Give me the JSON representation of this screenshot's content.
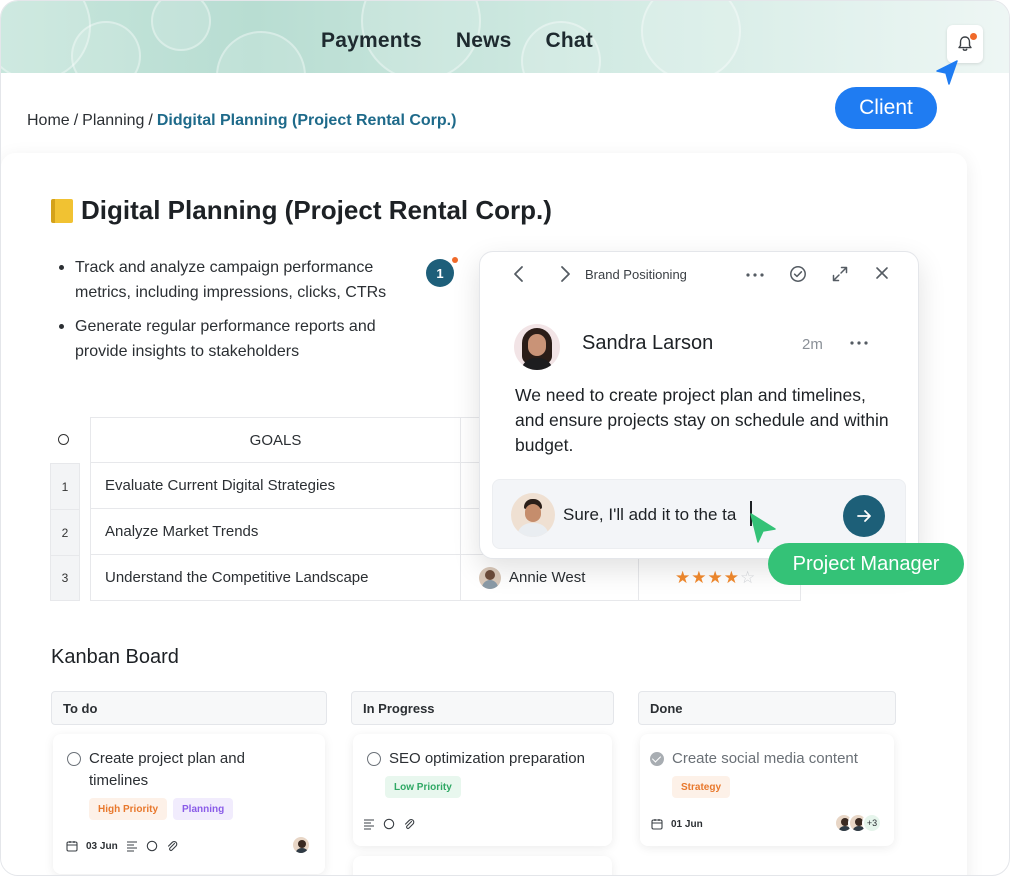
{
  "nav": {
    "items": [
      "Payments",
      "News",
      "Chat"
    ]
  },
  "cursors": {
    "client_label": "Client",
    "pm_label": "Project Manager"
  },
  "breadcrumb": {
    "home": "Home",
    "planning": "Planning",
    "current": "Didgital Planning (Project Rental Corp.)"
  },
  "page": {
    "title": "Digital Planning (Project Rental Corp.)",
    "bullets": [
      "Track and analyze campaign performance metrics, including impressions, clicks, CTRs",
      "Generate regular performance reports and provide insights to stakeholders"
    ],
    "comment_marker": "1"
  },
  "table": {
    "header": "GOALS",
    "rows": [
      {
        "index": "1",
        "goal": "Evaluate Current Digital Strategies"
      },
      {
        "index": "2",
        "goal": "Analyze Market Trends"
      },
      {
        "index": "3",
        "goal": "Understand the Competitive Landscape",
        "owner": "Annie West",
        "rating": 4,
        "rating_max": 5
      }
    ]
  },
  "comment": {
    "breadcrumb": "Brand Positioning",
    "author": "Sandra Larson",
    "time": "2m",
    "message": "We need to create project plan and timelines, and ensure projects stay on schedule and within budget.",
    "reply_draft": "Sure, I'll add it to the ta"
  },
  "kanban": {
    "title": "Kanban Board",
    "columns": [
      {
        "name": "To do",
        "cards": [
          {
            "title": "Create project plan and timelines",
            "tags": [
              "High Priority",
              "Planning"
            ],
            "date": "03 Jun"
          }
        ]
      },
      {
        "name": "In Progress",
        "cards": [
          {
            "title": "SEO optimization preparation",
            "tags": [
              "Low Priority"
            ]
          }
        ]
      },
      {
        "name": "Done",
        "cards": [
          {
            "title": "Create social media content",
            "tags": [
              "Strategy"
            ],
            "date": "01 Jun",
            "extra_assignees": "+3"
          }
        ]
      }
    ]
  },
  "colors": {
    "accent": "#1e5f7a",
    "client": "#1f7cf2",
    "pm": "#34c277",
    "star": "#f28a2e"
  }
}
